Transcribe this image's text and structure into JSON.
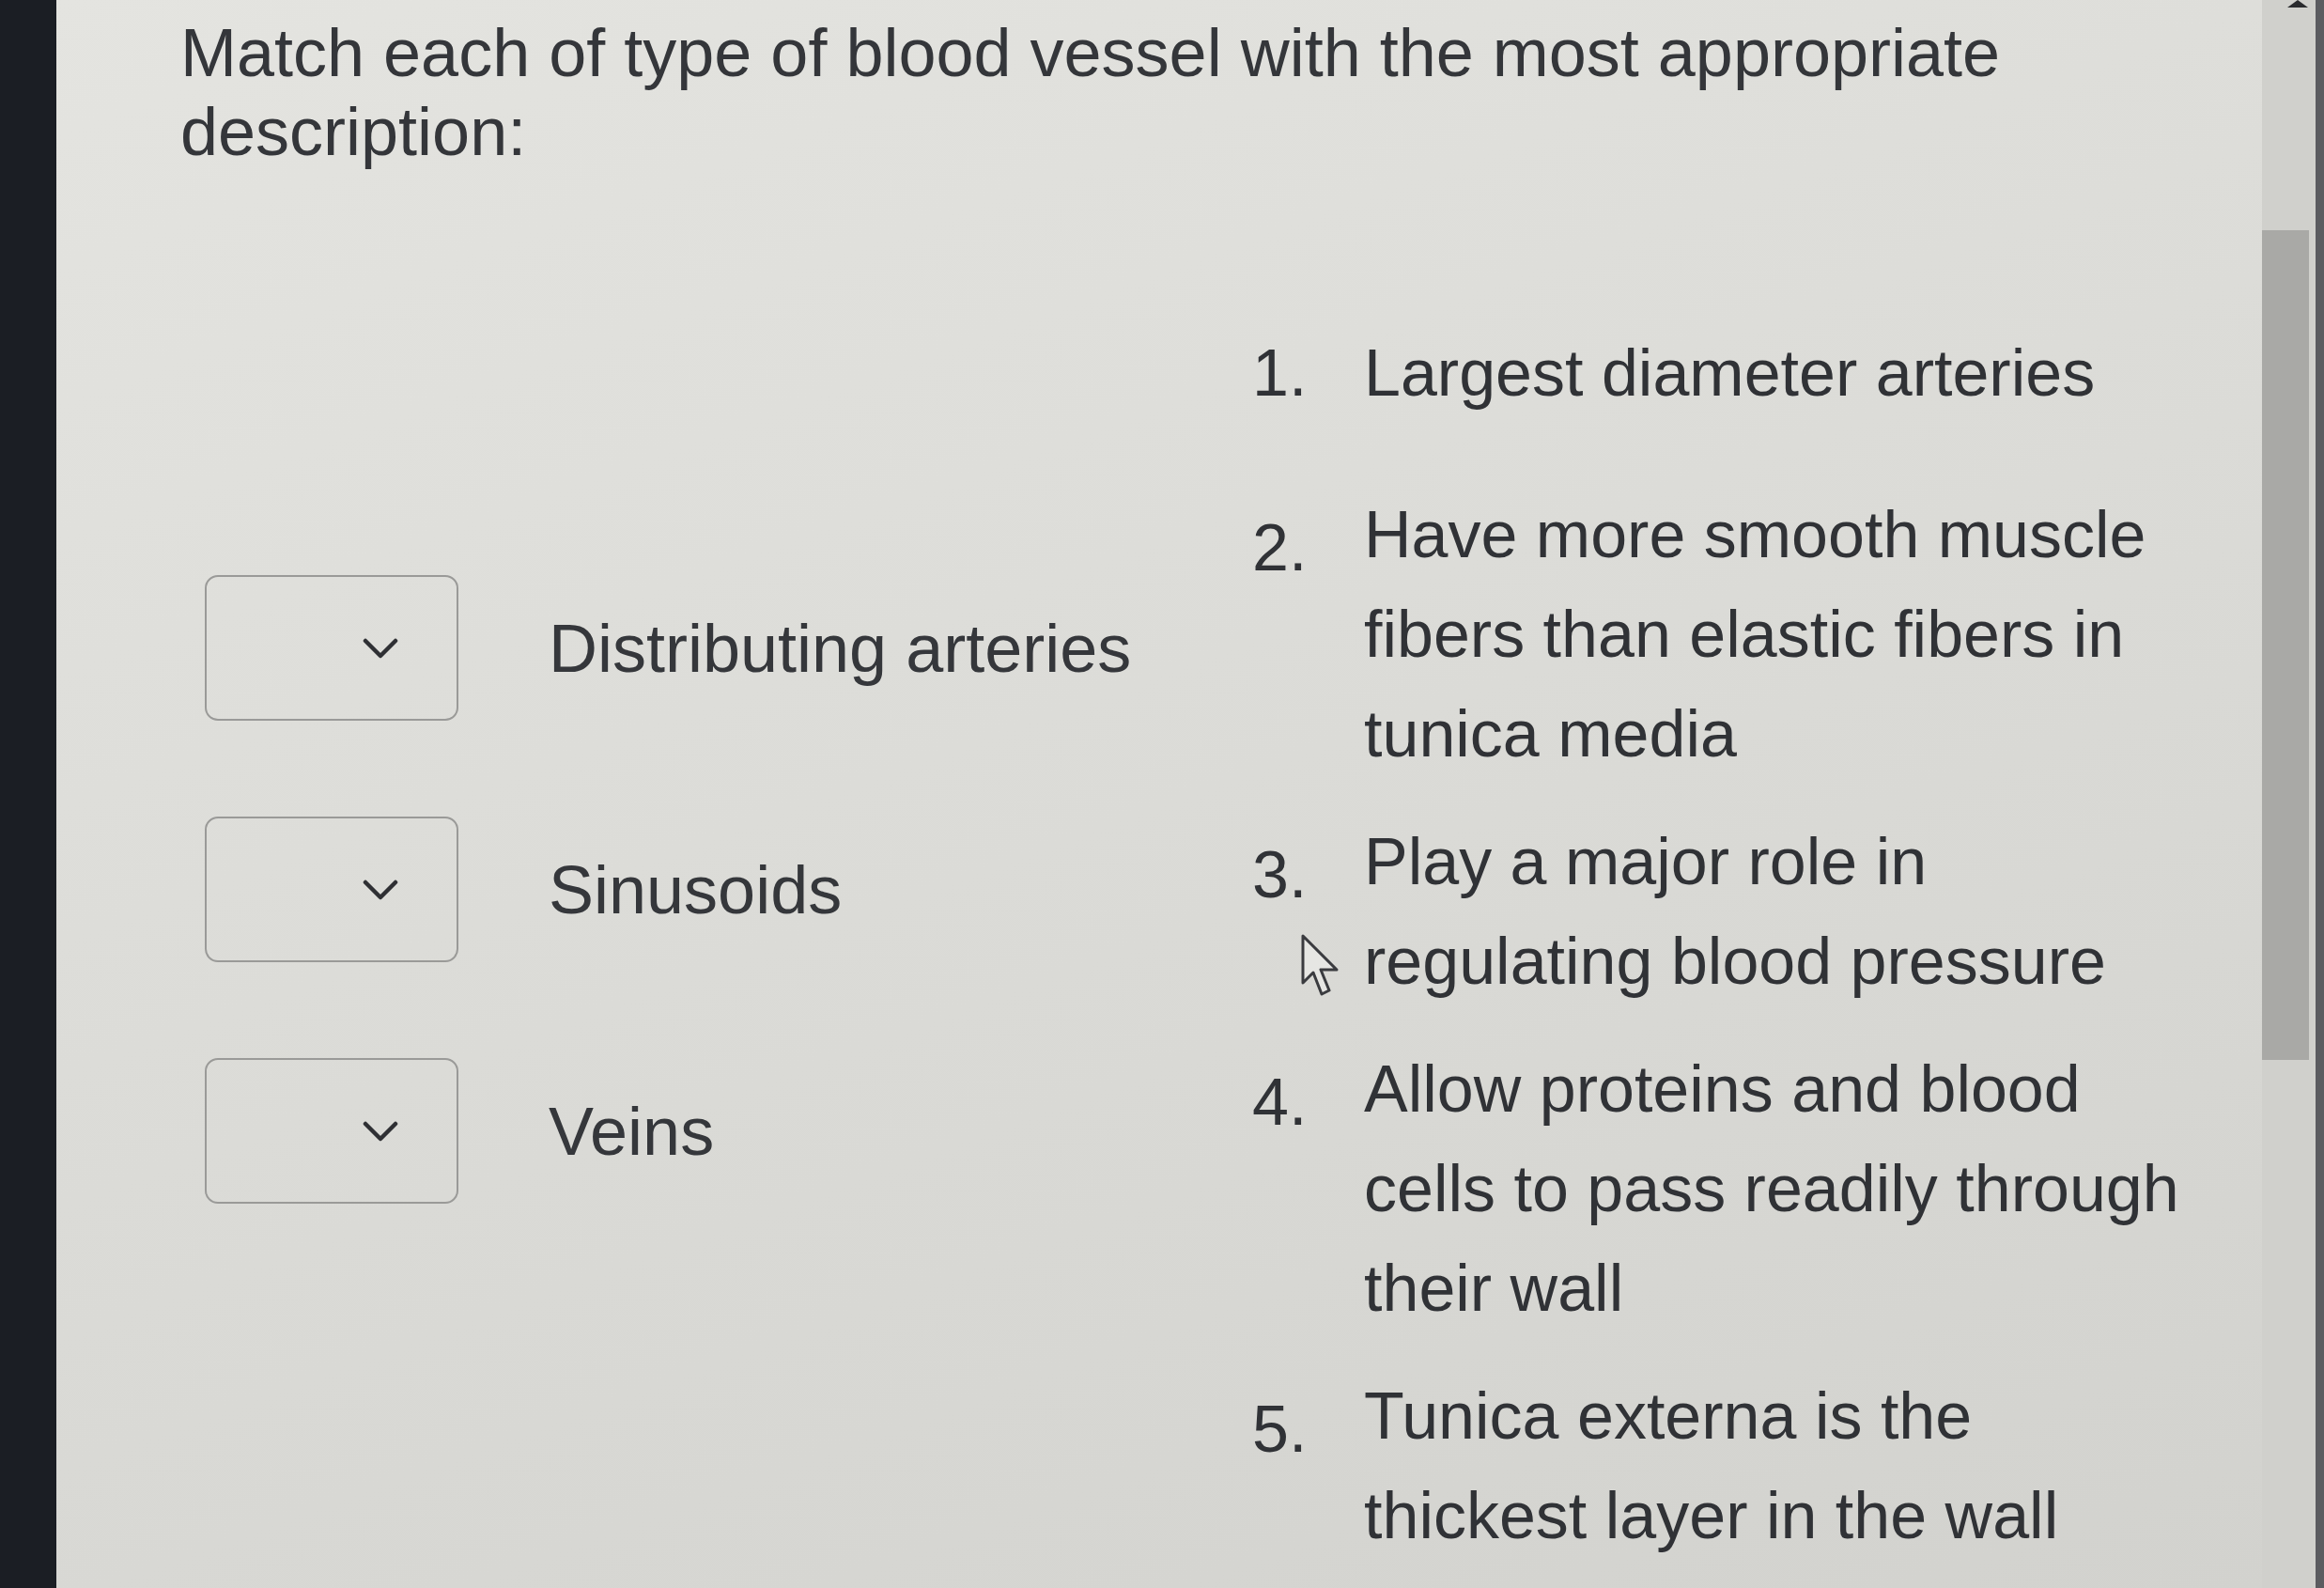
{
  "question": "Match each of type of blood vessel with the most appropriate description:",
  "matches": [
    {
      "term": "Distributing arteries"
    },
    {
      "term": "Sinusoids"
    },
    {
      "term": "Veins"
    }
  ],
  "descriptions": [
    {
      "number": "1.",
      "text": "Largest diameter arteries"
    },
    {
      "number": "2.",
      "text": "Have more smooth muscle fibers than elastic fibers in tunica media"
    },
    {
      "number": "3.",
      "text": "Play a major role in regulating blood pressure"
    },
    {
      "number": "4.",
      "text": "Allow proteins and blood cells to pass readily through their wall"
    },
    {
      "number": "5.",
      "text": "Tunica externa is the thickest layer in the wall"
    }
  ]
}
